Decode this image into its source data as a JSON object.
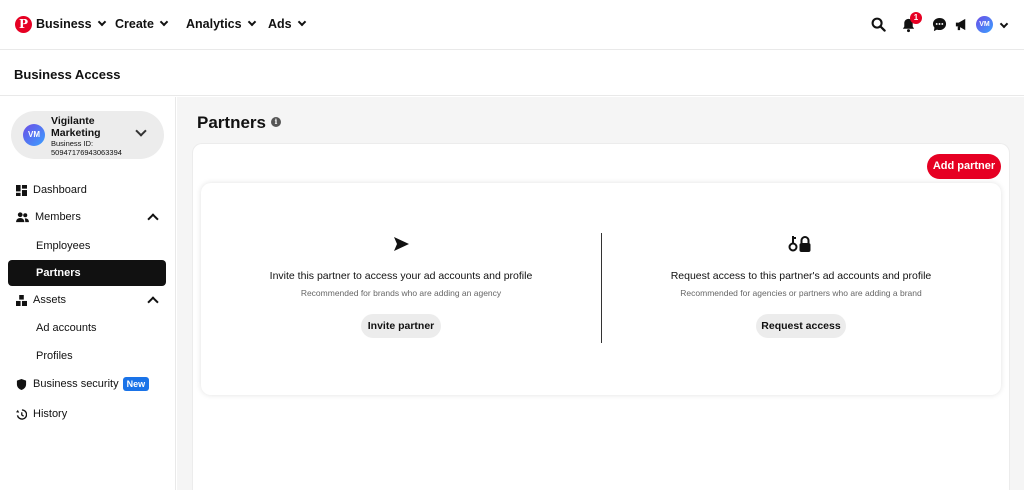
{
  "topnav": {
    "logo_glyph": "P",
    "items": [
      {
        "label": "Business"
      },
      {
        "label": "Create"
      },
      {
        "label": "Analytics"
      },
      {
        "label": "Ads"
      }
    ],
    "notification_count": "1",
    "avatar_initials": "VM",
    "brand_color": "#e60023"
  },
  "page_header": {
    "title": "Business Access"
  },
  "sidebar": {
    "business": {
      "name": "Vigilante Marketing",
      "id_label": "Business ID:",
      "id_value": "509471769430633​94",
      "avatar_initials": "VM"
    },
    "items": {
      "dashboard": "Dashboard",
      "members": "Members",
      "employees": "Employees",
      "partners": "Partners",
      "assets": "Assets",
      "ad_accounts": "Ad accounts",
      "profiles": "Profiles",
      "business_security": "Business security",
      "new_badge": "New",
      "history": "History"
    }
  },
  "main": {
    "title": "Partners",
    "add_partner_label": "Add partner",
    "invite": {
      "icon": "send-icon",
      "title": "Invite this partner to access your ad accounts and profile",
      "subtitle": "Recommended for brands who are adding an agency",
      "button": "Invite partner"
    },
    "request": {
      "icon": "key-lock-icon",
      "title": "Request access to this partner's ad accounts and profile",
      "subtitle": "Recommended for agencies or partners who are adding a brand",
      "button": "Request access"
    }
  }
}
